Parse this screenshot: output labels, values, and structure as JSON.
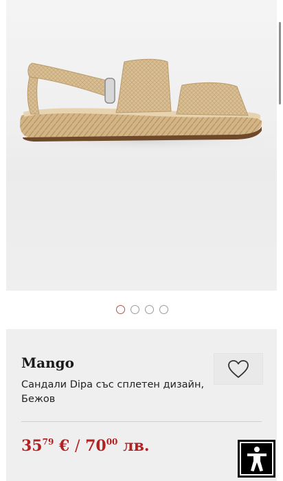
{
  "gallery": {
    "image_alt": "",
    "dot_count": 4,
    "active_index": 0
  },
  "product": {
    "brand": "Mango",
    "title": "Сандали Dipa със сплетен дизайн, Бежов",
    "price_eur_int": "35",
    "price_eur_dec": "79",
    "price_eur_symbol": "€",
    "separator": "/",
    "price_lev_int": "70",
    "price_lev_dec": "00",
    "price_lev_symbol": "лв."
  },
  "icons": {
    "wishlist": "heart-icon",
    "accessibility": "accessibility-icon"
  },
  "colors": {
    "price": "#b22222",
    "active_dot": "#b1534e",
    "card_background": "#efefef"
  }
}
